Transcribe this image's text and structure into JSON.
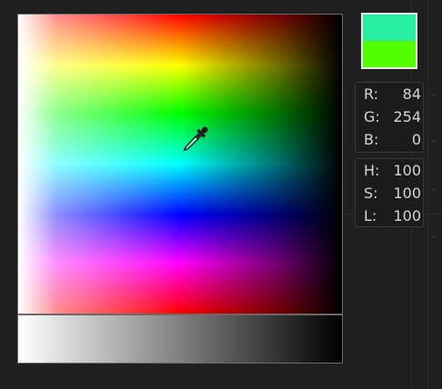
{
  "colors": {
    "panel_bg": "#1f1f1f",
    "old_color": "#29f0a0",
    "new_color": "#54fe00",
    "label_text": "#d6d6d6"
  },
  "cursor_icon": "eyedropper-icon",
  "rgb": {
    "r_label": "R:",
    "r_value": "84",
    "g_label": "G:",
    "g_value": "254",
    "b_label": "B:",
    "b_value": "0"
  },
  "hsl": {
    "h_label": "H:",
    "h_value": "100",
    "s_label": "S:",
    "s_value": "100",
    "l_label": "L:",
    "l_value": "100"
  }
}
